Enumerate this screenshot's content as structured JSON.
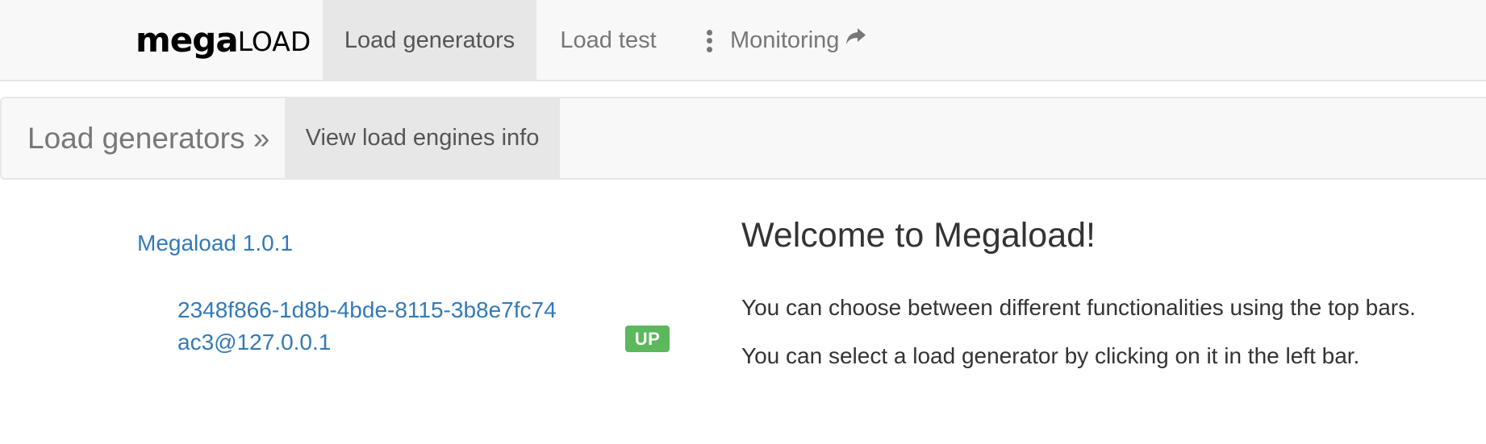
{
  "navbar": {
    "brand": {
      "mega": "mega",
      "load": "LOAD"
    },
    "items": [
      {
        "label": "Load generators",
        "active": true
      },
      {
        "label": "Load test",
        "active": false
      },
      {
        "label": "Monitoring",
        "active": false,
        "icon": "share-icon"
      }
    ]
  },
  "subnav": {
    "brand": "Load generators »",
    "link": "View load engines info"
  },
  "sidebar": {
    "version": "Megaload 1.0.1",
    "generators": [
      {
        "id": "2348f866-1d8b-4bde-8115-3b8e7fc74ac3@127.0.0.1",
        "status": "UP",
        "status_color": "#5cb85c"
      }
    ]
  },
  "main": {
    "title": "Welcome to Megaload!",
    "lines": [
      "You can choose between different functionalities using the top bars.",
      "You can select a load generator by clicking on it in the left bar."
    ]
  },
  "colors": {
    "link": "#337ab7",
    "navbar_bg": "#f8f8f8",
    "active_bg": "#e7e7e7",
    "success": "#5cb85c"
  }
}
